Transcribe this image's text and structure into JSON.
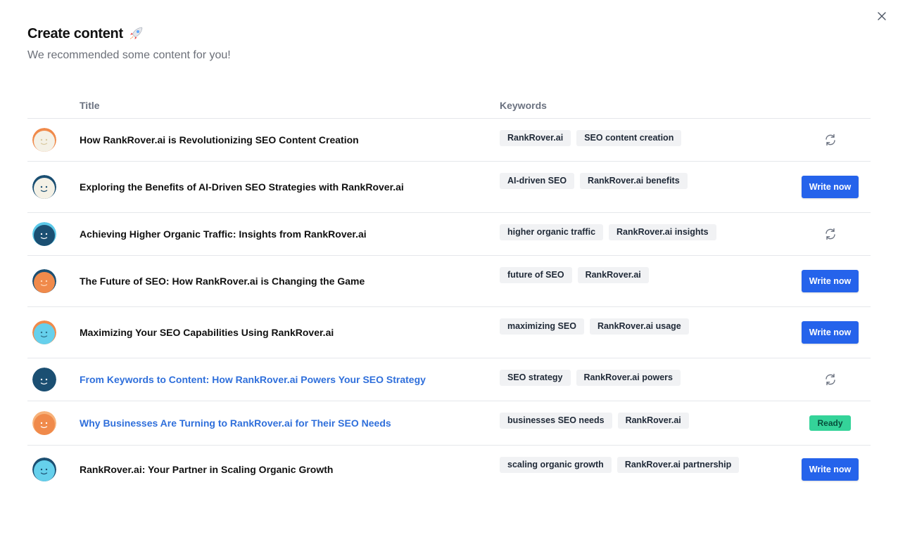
{
  "header": {
    "title": "Create content",
    "subtitle": "We recommended some content for you!",
    "title_icon": "rocket-icon"
  },
  "close_icon": "close-icon",
  "table": {
    "columns": {
      "title": "Title",
      "keywords": "Keywords"
    },
    "rows": [
      {
        "title": "How RankRover.ai is Revolutionizing SEO Content Creation",
        "keywords": [
          "RankRover.ai",
          "SEO content creation"
        ],
        "action": "refresh",
        "link": false
      },
      {
        "title": "Exploring the Benefits of AI-Driven SEO Strategies with RankRover.ai",
        "keywords": [
          "AI-driven SEO",
          "RankRover.ai benefits"
        ],
        "action": "write",
        "link": false
      },
      {
        "title": "Achieving Higher Organic Traffic: Insights from RankRover.ai",
        "keywords": [
          "higher organic traffic",
          "RankRover.ai insights"
        ],
        "action": "refresh",
        "link": false
      },
      {
        "title": "The Future of SEO: How RankRover.ai is Changing the Game",
        "keywords": [
          "future of SEO",
          "RankRover.ai"
        ],
        "action": "write",
        "link": false
      },
      {
        "title": "Maximizing Your SEO Capabilities Using RankRover.ai",
        "keywords": [
          "maximizing SEO",
          "RankRover.ai usage"
        ],
        "action": "write",
        "link": false
      },
      {
        "title": "From Keywords to Content: How RankRover.ai Powers Your SEO Strategy",
        "keywords": [
          "SEO strategy",
          "RankRover.ai powers"
        ],
        "action": "refresh",
        "link": true
      },
      {
        "title": "Why Businesses Are Turning to RankRover.ai for Their SEO Needs",
        "keywords": [
          "businesses SEO needs",
          "RankRover.ai"
        ],
        "action": "ready",
        "link": true
      },
      {
        "title": "RankRover.ai: Your Partner in Scaling Organic Growth",
        "keywords": [
          "scaling organic growth",
          "RankRover.ai partnership"
        ],
        "action": "write",
        "link": false
      }
    ]
  },
  "buttons": {
    "write_now": "Write now",
    "ready": "Ready"
  },
  "colors": {
    "primary": "#2563eb",
    "link": "#2f6fdb",
    "ready": "#34d399",
    "chip_bg": "#f1f2f4"
  }
}
